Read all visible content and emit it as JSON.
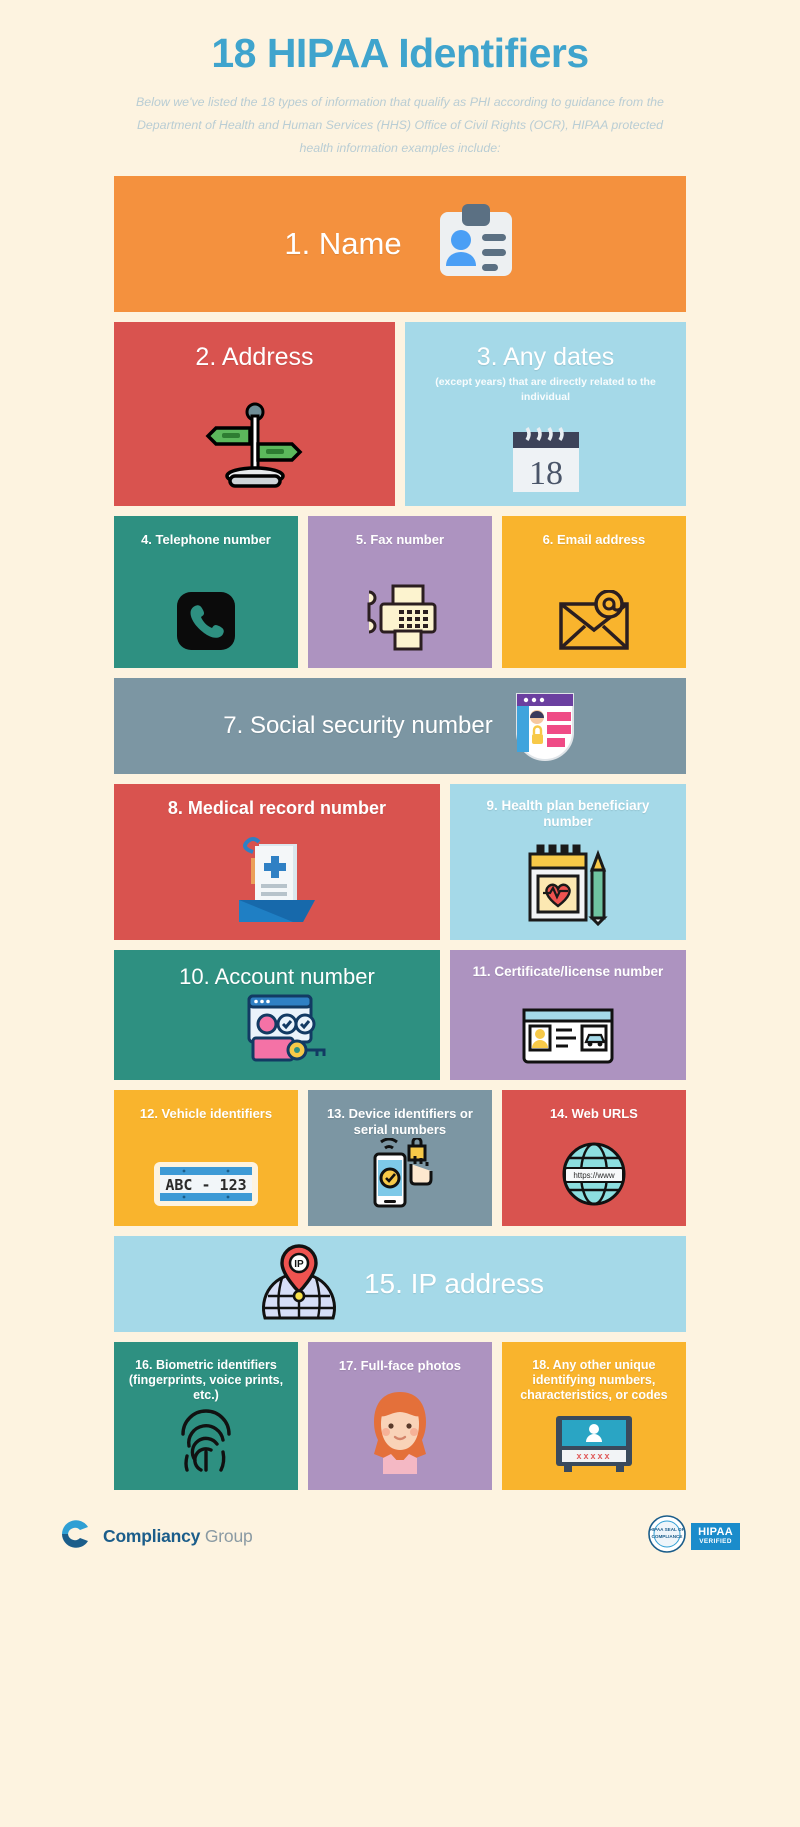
{
  "header": {
    "title": "18 HIPAA Identifiers",
    "subtitle": "Below we've listed the 18 types of information that qualify as PHI according to guidance from the Department of Health and Human Services (HHS) Office of Civil Rights (OCR), HIPAA protected health information examples include:"
  },
  "colors": {
    "page_background": "#fdf3e0",
    "title_blue": "#3fa4cd",
    "subtitle_gray": "#b9cdd4",
    "orange": "#f4913e",
    "red": "#d9534f",
    "light_blue": "#a5d9e8",
    "teal": "#2e9081",
    "purple": "#ad93c0",
    "yellow": "#f9b42d",
    "slate": "#7c96a3"
  },
  "identifiers": [
    {
      "n": 1,
      "label": "1. Name",
      "sub": "",
      "color": "#f4913e",
      "icon": "id-card-icon"
    },
    {
      "n": 2,
      "label": "2. Address",
      "sub": "",
      "color": "#d9534f",
      "icon": "signpost-icon"
    },
    {
      "n": 3,
      "label": "3. Any dates",
      "sub": "(except years) that are directly related to the individual",
      "color": "#a5d9e8",
      "icon": "calendar-icon",
      "calendar_day": "18"
    },
    {
      "n": 4,
      "label": "4. Telephone number",
      "sub": "",
      "color": "#2e9081",
      "icon": "phone-icon"
    },
    {
      "n": 5,
      "label": "5. Fax number",
      "sub": "",
      "color": "#ad93c0",
      "icon": "fax-machine-icon"
    },
    {
      "n": 6,
      "label": "6. Email address",
      "sub": "",
      "color": "#f9b42d",
      "icon": "envelope-at-icon"
    },
    {
      "n": 7,
      "label": "7. Social security number",
      "sub": "",
      "color": "#7c96a3",
      "icon": "secure-profile-shield-icon"
    },
    {
      "n": 8,
      "label": "8. Medical record number",
      "sub": "",
      "color": "#d9534f",
      "icon": "medical-file-icon"
    },
    {
      "n": 9,
      "label": "9. Health plan beneficiary number",
      "sub": "",
      "color": "#a5d9e8",
      "icon": "health-calendar-icon"
    },
    {
      "n": 10,
      "label": "10. Account number",
      "sub": "",
      "color": "#2e9081",
      "icon": "account-login-icon"
    },
    {
      "n": 11,
      "label": "11. Certificate/license number",
      "sub": "",
      "color": "#ad93c0",
      "icon": "drivers-license-icon"
    },
    {
      "n": 12,
      "label": "12. Vehicle identifiers",
      "sub": "",
      "color": "#f9b42d",
      "icon": "license-plate-icon",
      "plate_text": "ABC - 123"
    },
    {
      "n": 13,
      "label": "13. Device identifiers or serial numbers",
      "sub": "",
      "color": "#7c96a3",
      "icon": "smartphone-unlock-icon"
    },
    {
      "n": 14,
      "label": "14. Web URLS",
      "sub": "",
      "color": "#d9534f",
      "icon": "globe-url-icon",
      "url_text": "https://www"
    },
    {
      "n": 15,
      "label": "15. IP address",
      "sub": "",
      "color": "#a5d9e8",
      "icon": "map-pin-ip-icon",
      "pin_text": "IP"
    },
    {
      "n": 16,
      "label": "16. Biometric identifiers (fingerprints, voice prints, etc.)",
      "sub": "",
      "color": "#2e9081",
      "icon": "fingerprint-icon"
    },
    {
      "n": 17,
      "label": "17. Full-face photos",
      "sub": "",
      "color": "#ad93c0",
      "icon": "face-photo-icon"
    },
    {
      "n": 18,
      "label": "18. Any other unique identifying numbers, characteristics, or codes",
      "sub": "",
      "color": "#f9b42d",
      "icon": "secure-server-icon",
      "server_text": "xxxxx"
    }
  ],
  "footer": {
    "brand_primary": "Compliancy",
    "brand_secondary": "Group",
    "seal_top": "HIPAA SEAL OF",
    "seal_bottom": "COMPLIANCE",
    "badge_line1": "HIPAA",
    "badge_line2": "VERIFIED"
  }
}
